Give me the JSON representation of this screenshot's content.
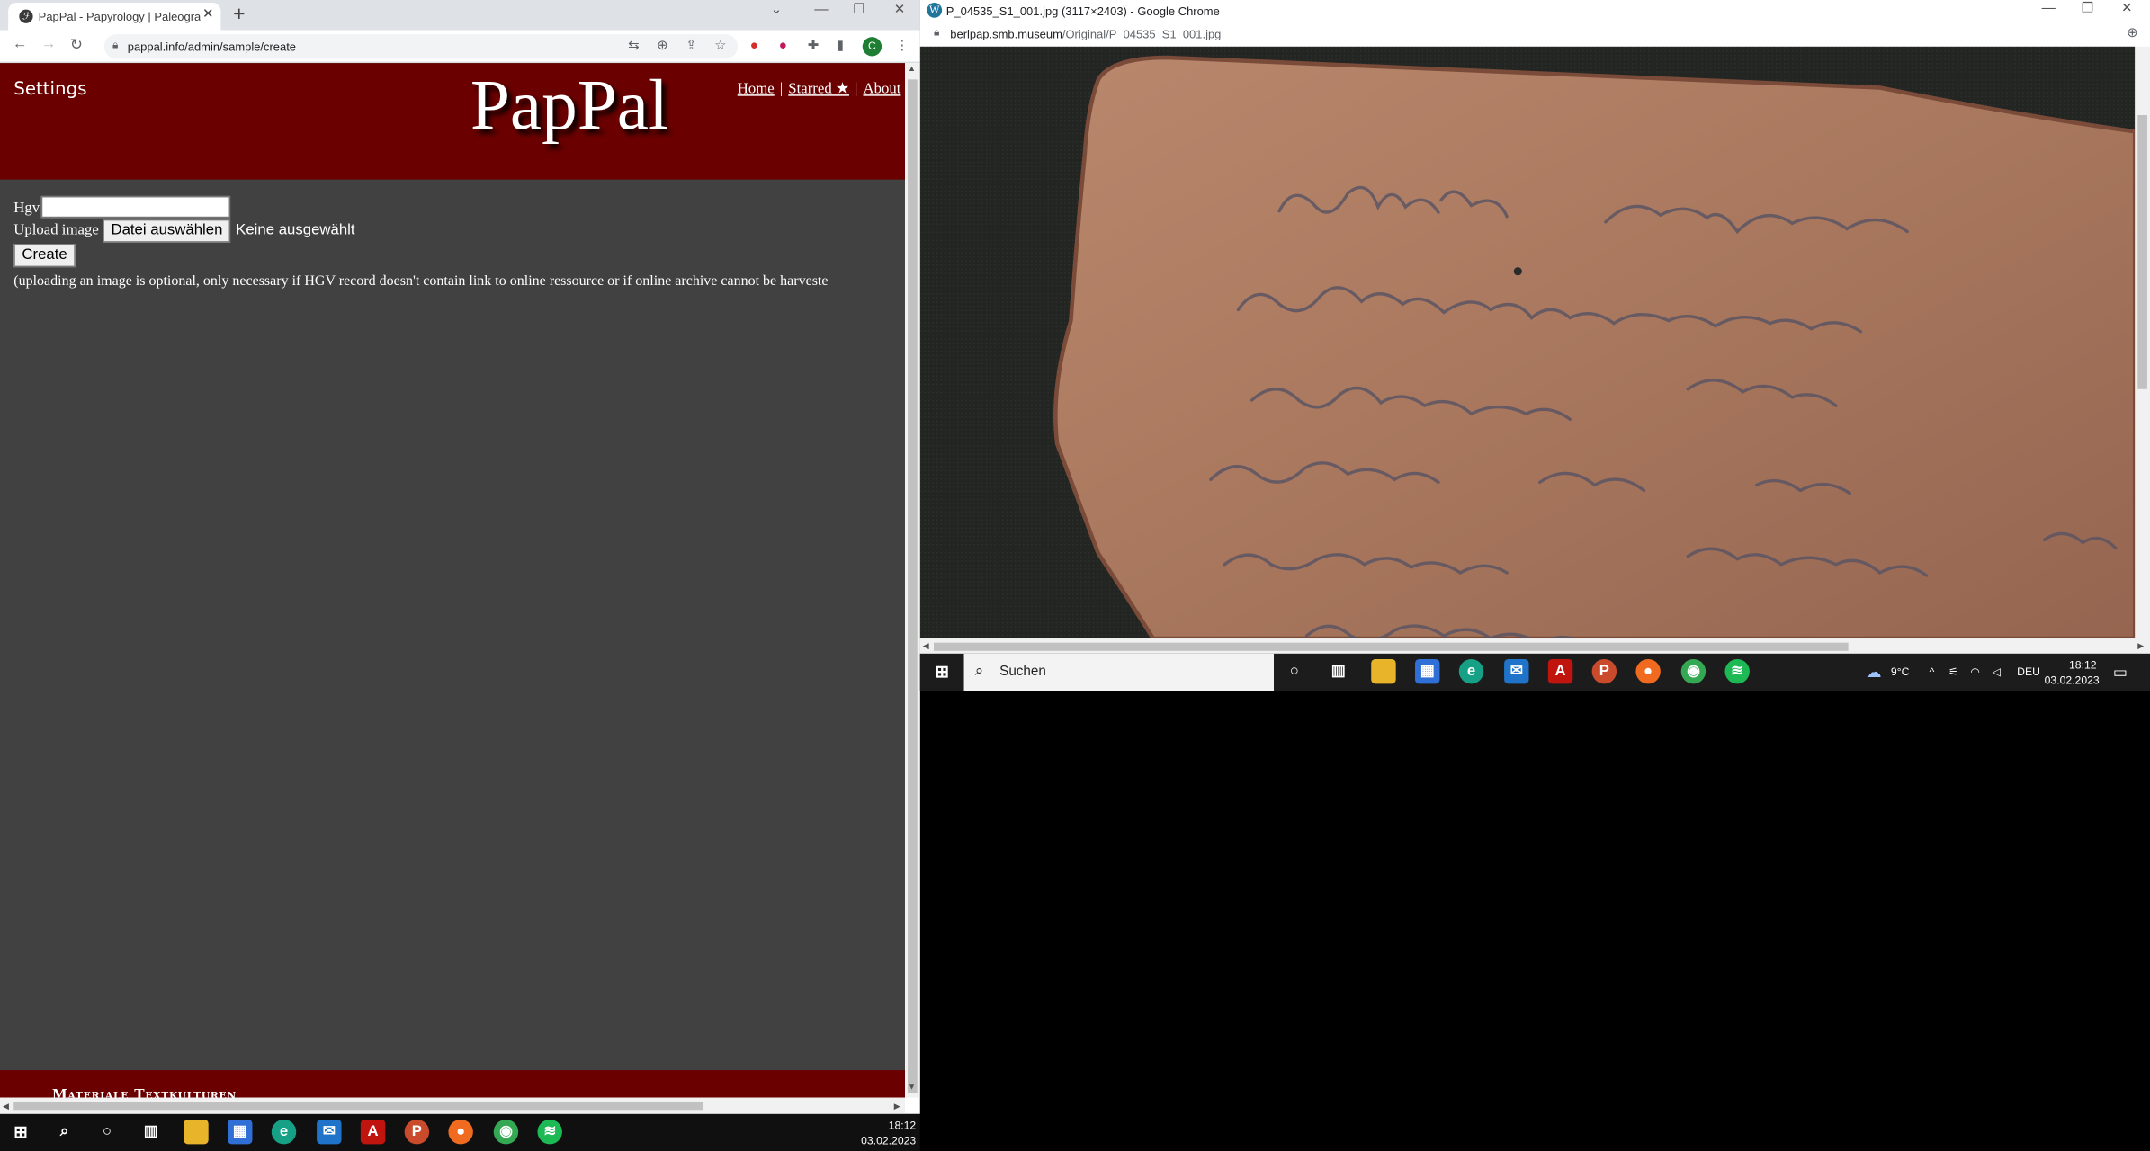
{
  "left_browser": {
    "tab_title": "PapPal - Papyrology | Paleograph",
    "url": "pappal.info/admin/sample/create",
    "profile_initial": "C"
  },
  "page": {
    "settings_label": "Settings",
    "logo": "PapPal",
    "nav": {
      "home": "Home",
      "starred": "Starred ★",
      "about": "About",
      "separator": "|"
    },
    "form": {
      "hgv_label": "Hgv",
      "hgv_value": "",
      "upload_label": "Upload image",
      "choose_file_label": "Datei auswählen",
      "no_file_text": "Keine ausgewählt",
      "create_label": "Create",
      "note": "(uploading an image is optional, only necessary if HGV record doesn't contain link to online ressource or if online archive cannot be harveste"
    },
    "footer_text": "Materiale Textkulturen"
  },
  "left_taskbar": {
    "time": "18:12",
    "date": "03.02.2023"
  },
  "right_browser": {
    "window_title": "P_04535_S1_001.jpg (3117×2403) - Google Chrome",
    "url_host": "berlpap.smb.museum",
    "url_path": "/Original/P_04535_S1_001.jpg"
  },
  "right_taskbar": {
    "search_label": "Suchen",
    "weather": "9°C",
    "language": "DEU",
    "time": "18:12",
    "date": "03.02.2023"
  },
  "colors": {
    "header_red": "#6b0001",
    "page_gray": "#414141",
    "taskbar": "#101010"
  }
}
